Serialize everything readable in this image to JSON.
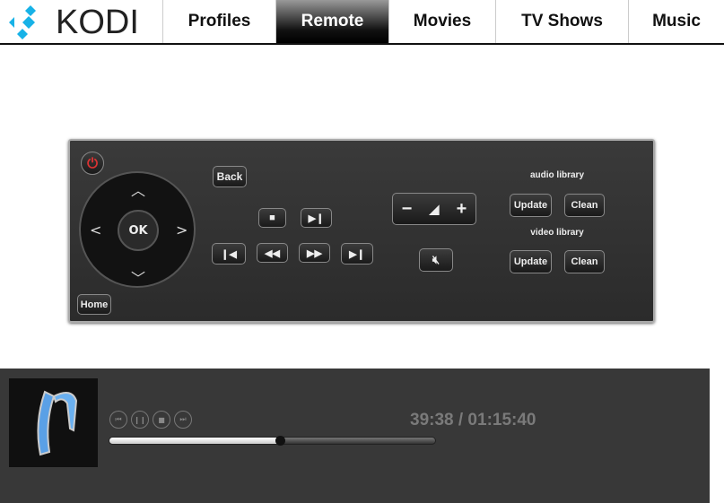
{
  "header": {
    "logo_text": "KODI",
    "tabs": [
      {
        "label": "Profiles",
        "active": false
      },
      {
        "label": "Remote",
        "active": true
      },
      {
        "label": "Movies",
        "active": false
      },
      {
        "label": "TV Shows",
        "active": false
      },
      {
        "label": "Music",
        "active": false
      }
    ]
  },
  "remote": {
    "back": "Back",
    "home": "Home",
    "ok": "OK",
    "audio_library_label": "audio library",
    "video_library_label": "video library",
    "update": "Update",
    "clean": "Clean",
    "power_color": "#c0392b"
  },
  "player": {
    "time": "39:38 / 01:15:40",
    "progress_fraction": 0.524
  }
}
